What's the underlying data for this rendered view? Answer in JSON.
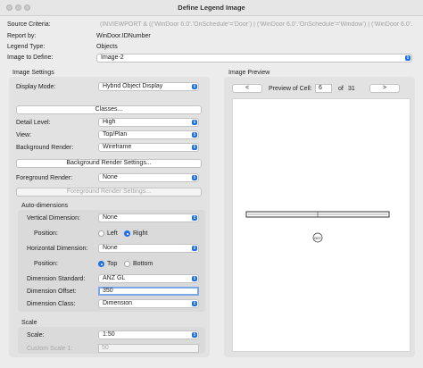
{
  "window": {
    "title": "Define Legend Image"
  },
  "header": {
    "source_label": "Source Criteria:",
    "source_value": "(INVIEWPORT & ((‘WinDoor 6.0’.’OnSchedule’=’Door’) | (‘WinDoor 6.0’.’OnSchedule’=’Window’) | (‘WinDoor 6.0’.",
    "report_label": "Report by:",
    "report_value": "WinDoor.IDNumber",
    "legend_type_label": "Legend Type:",
    "legend_type_value": "Objects",
    "image_define_label": "Image to Define:",
    "image_define_value": "Image-2"
  },
  "settings": {
    "section_title": "Image Settings",
    "display_mode_label": "Display Mode:",
    "display_mode_value": "Hybrid Object Display",
    "classes_button": "Classes...",
    "detail_level_label": "Detail Level:",
    "detail_level_value": "High",
    "view_label": "View:",
    "view_value": "Top/Plan",
    "bg_render_label": "Background Render:",
    "bg_render_value": "Wireframe",
    "bg_render_settings_button": "Background Render Settings...",
    "fg_render_label": "Foreground Render:",
    "fg_render_value": "None",
    "fg_render_settings_button": "Foreground Render Settings..."
  },
  "auto_dimensions": {
    "title": "Auto-dimensions",
    "vertical_label": "Vertical Dimension:",
    "vertical_value": "None",
    "v_position_label": "Position:",
    "v_left": "Left",
    "v_right": "Right",
    "v_selected": "Right",
    "horizontal_label": "Horizontal Dimension:",
    "horizontal_value": "None",
    "h_position_label": "Position:",
    "h_top": "Top",
    "h_bottom": "Bottom",
    "h_selected": "Top",
    "standard_label": "Dimension Standard:",
    "standard_value": "ANZ GL",
    "offset_label": "Dimension Offset:",
    "offset_value": "350",
    "class_label": "Dimension Class:",
    "class_value": "Dimension"
  },
  "scale": {
    "title": "Scale",
    "scale_label": "Scale:",
    "scale_value": "1:50",
    "custom_label": "Custom Scale 1:",
    "custom_value": "50"
  },
  "preview": {
    "title": "Image Preview",
    "prev_button": "<",
    "next_button": ">",
    "cell_label": "Preview of Cell:",
    "cell_value": "6",
    "of_label": "of",
    "total": "31",
    "tag_text": "D07"
  },
  "colors": {
    "accent": "#1f6fe5",
    "window_bg": "#ececec",
    "group_bg": "#e2e2e2"
  },
  "icons": {
    "popup_indicator": "chevron-updown-icon",
    "radio": "radio-button-icon"
  }
}
